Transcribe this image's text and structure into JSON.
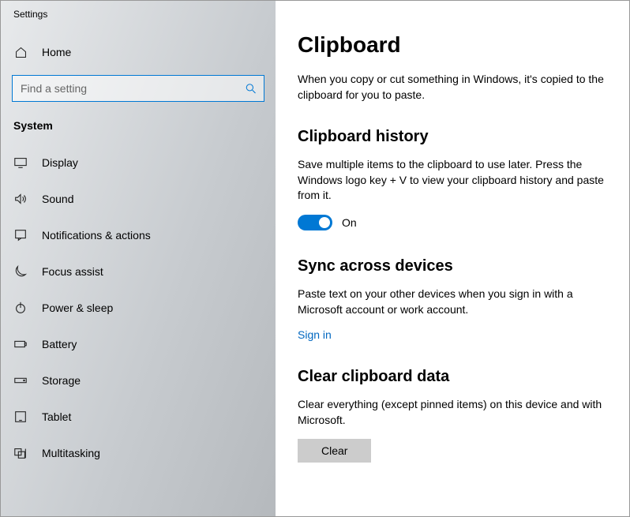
{
  "window_title": "Settings",
  "sidebar": {
    "home_label": "Home",
    "search_placeholder": "Find a setting",
    "category_label": "System",
    "items": [
      {
        "label": "Display"
      },
      {
        "label": "Sound"
      },
      {
        "label": "Notifications & actions"
      },
      {
        "label": "Focus assist"
      },
      {
        "label": "Power & sleep"
      },
      {
        "label": "Battery"
      },
      {
        "label": "Storage"
      },
      {
        "label": "Tablet"
      },
      {
        "label": "Multitasking"
      }
    ]
  },
  "main": {
    "title": "Clipboard",
    "intro": "When you copy or cut something in Windows, it's copied to the clipboard for you to paste.",
    "history": {
      "title": "Clipboard history",
      "body": "Save multiple items to the clipboard to use later. Press the Windows logo key + V to view your clipboard history and paste from it.",
      "toggle_state": "On"
    },
    "sync": {
      "title": "Sync across devices",
      "body": "Paste text on your other devices when you sign in with a Microsoft account or work account.",
      "link": "Sign in"
    },
    "clear": {
      "title": "Clear clipboard data",
      "body": "Clear everything (except pinned items) on this device and with Microsoft.",
      "button": "Clear"
    }
  }
}
